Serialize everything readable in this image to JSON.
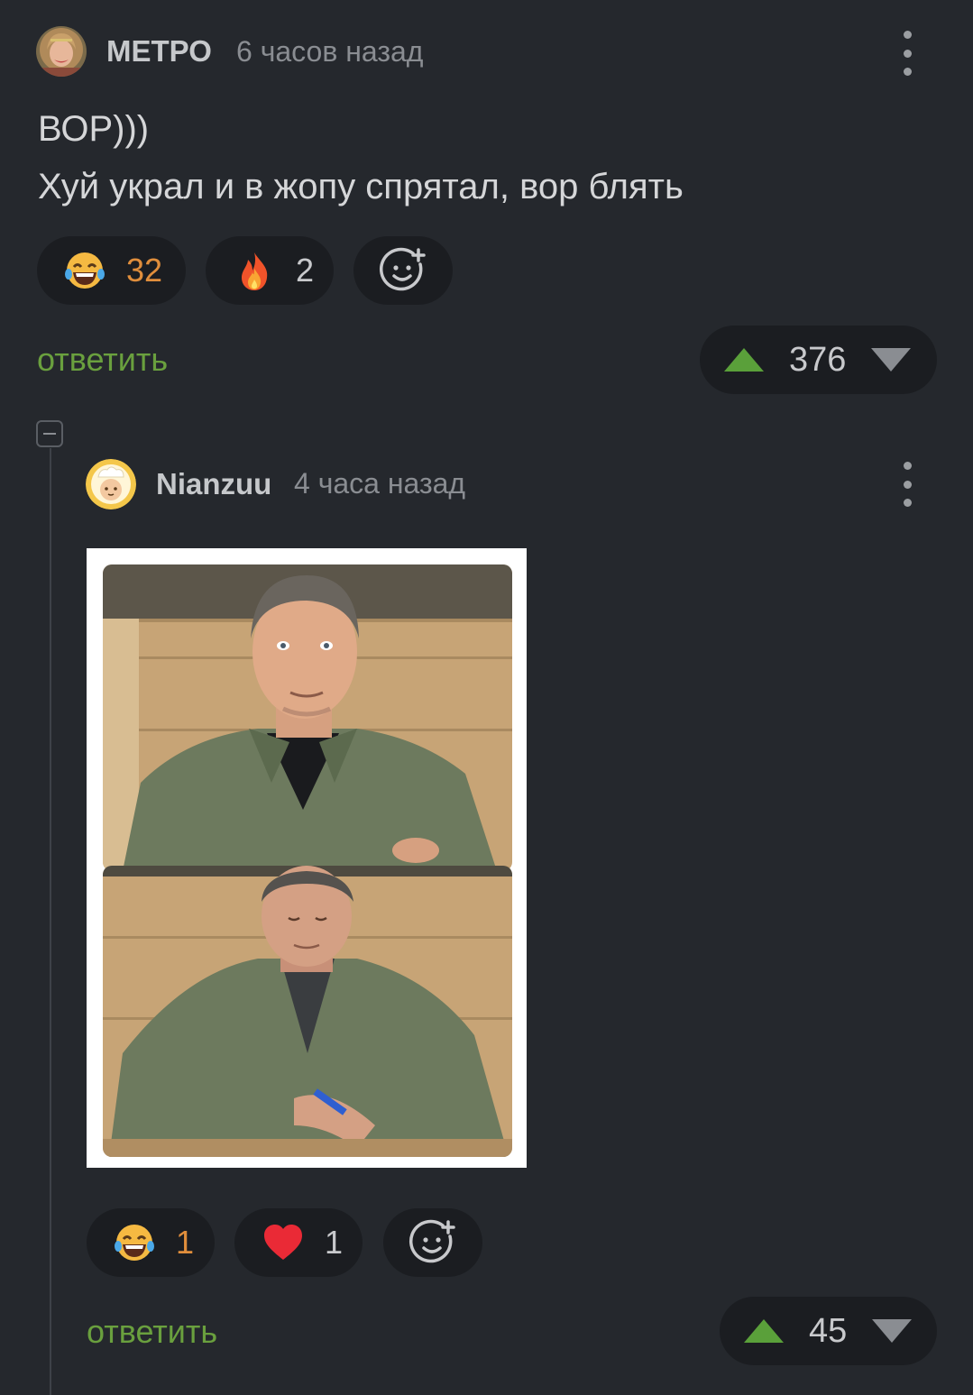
{
  "comments": [
    {
      "author": "МЕТРО",
      "time": "6 часов назад",
      "lines": [
        "ВОР)))",
        "Хуй украл и в жопу спрятал, вор блять"
      ],
      "reactions": [
        {
          "icon": "laughing-tears-emoji",
          "count": "32"
        },
        {
          "icon": "fire-emoji",
          "count": "2"
        },
        {
          "icon": "add-reaction-icon",
          "count": ""
        }
      ],
      "reply_label": "ответить",
      "rating": "376"
    },
    {
      "author": "Nianzuu",
      "time": "4 часа назад",
      "image": "two-panel-photo-man-in-green-shirt",
      "reactions": [
        {
          "icon": "laughing-tears-emoji",
          "count": "1"
        },
        {
          "icon": "red-heart-emoji",
          "count": "1"
        },
        {
          "icon": "add-reaction-icon",
          "count": ""
        }
      ],
      "reply_label": "ответить",
      "rating": "45"
    }
  ],
  "colors": {
    "background": "#25282d",
    "reply_green": "#6aa03e",
    "upvote_green": "#5aa03a",
    "reaction_orange": "#e08e3c"
  }
}
